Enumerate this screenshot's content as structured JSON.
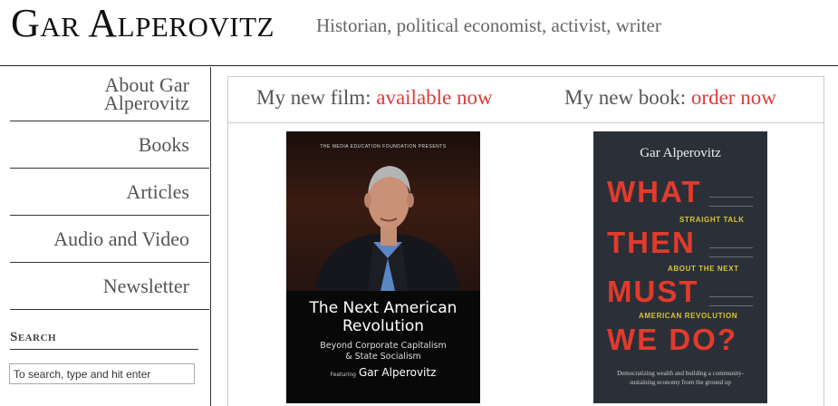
{
  "header": {
    "site_title": "Gar Alperovitz",
    "tagline": "Historian, political economist, activist, writer"
  },
  "nav": {
    "items": [
      {
        "label_line1": "About Gar",
        "label_line2": "Alperovitz"
      },
      {
        "label": "Books"
      },
      {
        "label": "Articles"
      },
      {
        "label": "Audio and Video"
      },
      {
        "label": "Newsletter"
      }
    ]
  },
  "search": {
    "heading": "Search",
    "placeholder": "To search, type and hit enter"
  },
  "promos": {
    "film_prefix": "My new film:",
    "film_link": "available now",
    "book_prefix": "My new book:",
    "book_link": "order now"
  },
  "film_cover": {
    "presents": "THE MEDIA EDUCATION FOUNDATION PRESENTS",
    "title_line1": "The Next American",
    "title_line2": "Revolution",
    "subtitle_line1": "Beyond Corporate Capitalism",
    "subtitle_line2": "& State Socialism",
    "featuring_label": "Featuring",
    "featuring_name": "Gar Alperovitz"
  },
  "book_cover": {
    "author": "Gar Alperovitz",
    "word1": "WHAT",
    "word2": "THEN",
    "word3": "MUST",
    "word4": "WE DO?",
    "tag1": "STRAIGHT TALK",
    "tag2": "ABOUT THE NEXT",
    "tag3": "AMERICAN REVOLUTION",
    "bottom_line1": "Democratizing wealth and building a community-",
    "bottom_line2": "sustaining economy from the ground up",
    "colors": {
      "background": "#2b3038",
      "title": "#e23a2c",
      "tagline": "#d9c43a"
    }
  },
  "colors": {
    "link": "#e03a3a",
    "text": "#555555"
  }
}
